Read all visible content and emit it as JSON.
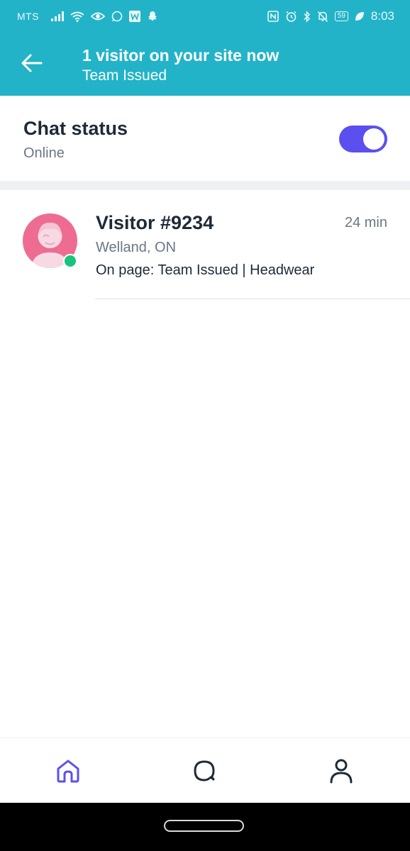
{
  "status_bar": {
    "carrier": "MTS",
    "battery": "59",
    "time": "8:03",
    "left_icons": [
      "signal-icon",
      "wifi-icon",
      "eye-icon",
      "whatsapp-icon",
      "w-app-icon",
      "snapchat-icon"
    ],
    "right_icons": [
      "nfc-icon",
      "alarm-icon",
      "bluetooth-icon",
      "mute-bell-icon",
      "battery-icon",
      "leaf-icon"
    ]
  },
  "header": {
    "title": "1 visitor on your site now",
    "subtitle": "Team Issued",
    "back_icon": "back-arrow-icon"
  },
  "chat_status": {
    "label": "Chat status",
    "value": "Online",
    "toggle_on": true
  },
  "visitors": [
    {
      "name": "Visitor #9234",
      "time": "24 min",
      "location": "Welland, ON",
      "page": "On page: Team Issued | Headwear",
      "online": true
    }
  ],
  "bottom_nav": {
    "items": [
      {
        "icon": "home-icon",
        "active": true
      },
      {
        "icon": "chat-icon",
        "active": false
      },
      {
        "icon": "profile-icon",
        "active": false
      }
    ]
  },
  "colors": {
    "header_bg": "#23b3c8",
    "accent": "#5b4ff0",
    "avatar_bg": "#ee6c92",
    "online": "#18c47c"
  }
}
